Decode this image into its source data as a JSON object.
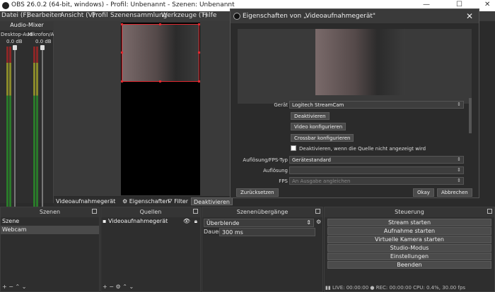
{
  "window": {
    "title": "OBS 26.0.2 (64-bit, windows) - Profil: Unbenannt - Szenen: Unbenannt",
    "minimize": "—",
    "maximize": "☐",
    "close": "✕"
  },
  "menu": [
    "Datei (F)",
    "Bearbeiten",
    "Ansicht (V)",
    "Profil",
    "Szenensammlung",
    "Werkzeuge (T)",
    "Hilfe"
  ],
  "audio_mixer": {
    "title": "Audio-Mixer",
    "channels": [
      {
        "name": "Desktop-Aud",
        "db": "0.0 dB",
        "level": 0.0
      },
      {
        "name": "Mikrofon/AU",
        "db": "0.0 dB",
        "level": 0.0
      }
    ]
  },
  "source_bar": {
    "source_name": "Videoaufnahmegerät",
    "properties": "Eigenschaften",
    "filters": "Filter",
    "deactivate": "Deaktivieren"
  },
  "docks": {
    "scenes": {
      "title": "Szenen",
      "items": [
        "Szene",
        "Webcam"
      ],
      "selected": 1
    },
    "sources": {
      "title": "Quellen",
      "items": [
        "Videoaufnahmegerät"
      ]
    },
    "transitions": {
      "title": "Szenenübergänge",
      "type": "Überblende",
      "duration_label": "Dauer",
      "duration": "300 ms"
    },
    "controls": {
      "title": "Steuerung",
      "buttons": [
        "Stream starten",
        "Aufnahme starten",
        "Virtuelle Kamera starten",
        "Studio-Modus",
        "Einstellungen",
        "Beenden"
      ]
    }
  },
  "footer_icons": {
    "add": "+",
    "remove": "−",
    "up": "⌃",
    "down": "⌄",
    "gear": "⚙"
  },
  "status": {
    "live": "LIVE: 00:00:00",
    "rec": "REC: 00:00:00",
    "cpu": "CPU: 0.4%, 30.00 fps"
  },
  "dialog": {
    "title": "Eigenschaften von „Videoaufnahmegerät\"",
    "device_label": "Gerät",
    "device_value": "Logitech StreamCam",
    "btn_deactivate": "Deaktivieren",
    "btn_video_config": "Video konfigurieren",
    "btn_crossbar_config": "Crossbar konfigurieren",
    "checkbox_label": "Deaktivieren, wenn die Quelle nicht angezeigt wird",
    "resolution_type_label": "Auflösung/FPS-Typ",
    "resolution_type_value": "Gerätestandard",
    "resolution_label": "Auflösung",
    "resolution_value": "",
    "fps_label": "FPS",
    "fps_value": "An Ausgabe angleichen",
    "reset": "Zurücksetzen",
    "ok": "Okay",
    "cancel": "Abbrechen"
  }
}
